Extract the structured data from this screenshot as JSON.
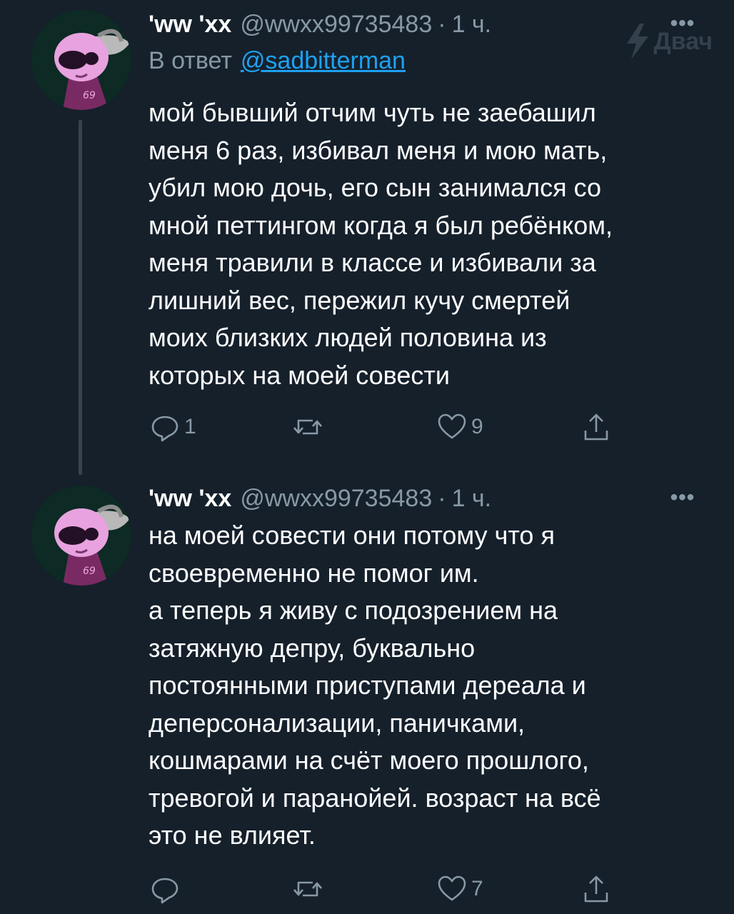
{
  "watermark": {
    "text": "Двач"
  },
  "colors": {
    "background": "#15202b",
    "text": "#ffffff",
    "secondary": "#8899a6",
    "link": "#1da1f2",
    "thread_line": "#38444d"
  },
  "tweets": [
    {
      "display_name": "'ww 'xx",
      "handle": "@wwxx99735483",
      "separator": "·",
      "time": "1 ч.",
      "more_icon": "more-horizontal-icon",
      "more_label": "•••",
      "reply_to": {
        "prefix": "В ответ",
        "mention": "@sadbitterman"
      },
      "text": "мой бывший отчим чуть не заебашил\nменя 6 раз, избивал меня и мою мать,\nубил мою дочь, его сын занимался со\nмной петтингом когда я был ребёнком,\nменя травили в классе и избивали за\nлишний вес, пережил кучу смертей\nмоих близких людей половина из\nкоторых на моей совести",
      "actions": {
        "reply_count": "1",
        "retweet_count": "",
        "like_count": "9"
      }
    },
    {
      "display_name": "'ww 'xx",
      "handle": "@wwxx99735483",
      "separator": "·",
      "time": "1 ч.",
      "more_icon": "more-horizontal-icon",
      "more_label": "•••",
      "text": "на моей совести они потому что я\nсвоевременно не помог им.\nа теперь я живу с подозрением на\nзатяжную депру, буквально\nпостоянными приступами дереала и\nдеперсонализации, паничками,\nкошмарами на счёт моего прошлого,\nтревогой и паранойей. возраст на всё\nэто не влияет.",
      "actions": {
        "reply_count": "",
        "retweet_count": "",
        "like_count": "7"
      }
    }
  ]
}
